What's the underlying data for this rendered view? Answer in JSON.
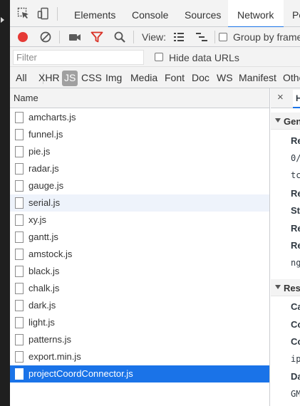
{
  "main_tabs": [
    "Elements",
    "Console",
    "Sources",
    "Network",
    "Pe"
  ],
  "active_tab": "Network",
  "toolbar": {
    "view_label": "View:",
    "group_by_frame_label": "Group by frame"
  },
  "filter": {
    "placeholder": "Filter",
    "hide_data_urls_label": "Hide data URLs"
  },
  "type_filters": [
    "All",
    "XHR",
    "JS",
    "CSS",
    "Img",
    "Media",
    "Font",
    "Doc",
    "WS",
    "Manifest",
    "Othe"
  ],
  "active_type_filter": "JS",
  "requests": {
    "column_header": "Name",
    "items": [
      {
        "name": "amcharts.js"
      },
      {
        "name": "funnel.js"
      },
      {
        "name": "pie.js"
      },
      {
        "name": "radar.js"
      },
      {
        "name": "gauge.js"
      },
      {
        "name": "serial.js"
      },
      {
        "name": "xy.js"
      },
      {
        "name": "gantt.js"
      },
      {
        "name": "amstock.js"
      },
      {
        "name": "black.js"
      },
      {
        "name": "chalk.js"
      },
      {
        "name": "dark.js"
      },
      {
        "name": "light.js"
      },
      {
        "name": "patterns.js"
      },
      {
        "name": "export.min.js"
      },
      {
        "name": "projectCoordConnector.js"
      }
    ],
    "hovered": "serial.js",
    "selected": "projectCoordConnector.js"
  },
  "details": {
    "close_glyph": "×",
    "tab_label": "H",
    "general_section": "Gen",
    "general_lines": [
      {
        "kind": "key",
        "text": "Re"
      },
      {
        "kind": "val",
        "text": "0/"
      },
      {
        "kind": "val",
        "text": "tc"
      },
      {
        "kind": "key",
        "text": "Re"
      },
      {
        "kind": "key",
        "text": "St"
      },
      {
        "kind": "key",
        "text": "Re"
      },
      {
        "kind": "key",
        "text": "Re"
      },
      {
        "kind": "val",
        "text": "ng"
      }
    ],
    "response_section": "Res",
    "response_lines": [
      {
        "kind": "key",
        "text": "Ca"
      },
      {
        "kind": "key",
        "text": "Co"
      },
      {
        "kind": "key",
        "text": "Co"
      },
      {
        "kind": "val",
        "text": "ip"
      },
      {
        "kind": "key",
        "text": "Da"
      },
      {
        "kind": "val",
        "text": "GM"
      }
    ]
  },
  "colors": {
    "accent": "#1a73e8",
    "record": "#e53935",
    "filter_icon": "#d93025"
  }
}
